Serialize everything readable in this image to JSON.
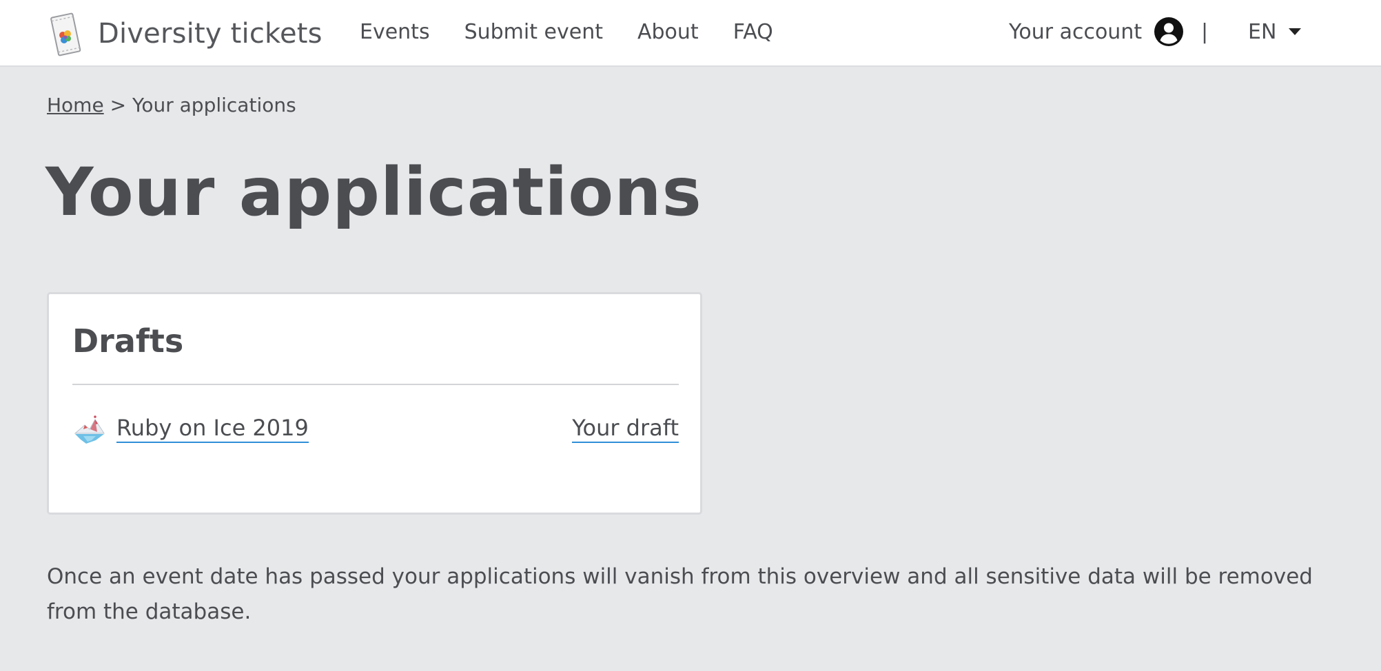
{
  "header": {
    "brand_name": "Diversity tickets",
    "brand_logo_icon": "ticket-logo-icon",
    "nav": [
      {
        "label": "Events"
      },
      {
        "label": "Submit event"
      },
      {
        "label": "About"
      },
      {
        "label": "FAQ"
      }
    ],
    "account_label": "Your account",
    "account_icon": "user-circle-icon",
    "separator": "|",
    "language": "EN",
    "language_icon": "caret-down-icon"
  },
  "breadcrumb": {
    "home_label": "Home",
    "separator": ">",
    "current": "Your applications"
  },
  "main": {
    "title": "Your applications",
    "drafts": {
      "heading": "Drafts",
      "items": [
        {
          "event_name": "Ruby on Ice 2019",
          "event_icon": "event-logo-icon",
          "status_link": "Your draft"
        }
      ]
    },
    "notice": "Once an event date has passed your applications will vanish from this overview and all sensitive data will be removed from the database."
  },
  "colors": {
    "page_background": "#e7e8ea",
    "header_background": "#ffffff",
    "text": "#4b4d51",
    "link_underline": "#2f8fd8",
    "card_border": "#d9dadd"
  }
}
